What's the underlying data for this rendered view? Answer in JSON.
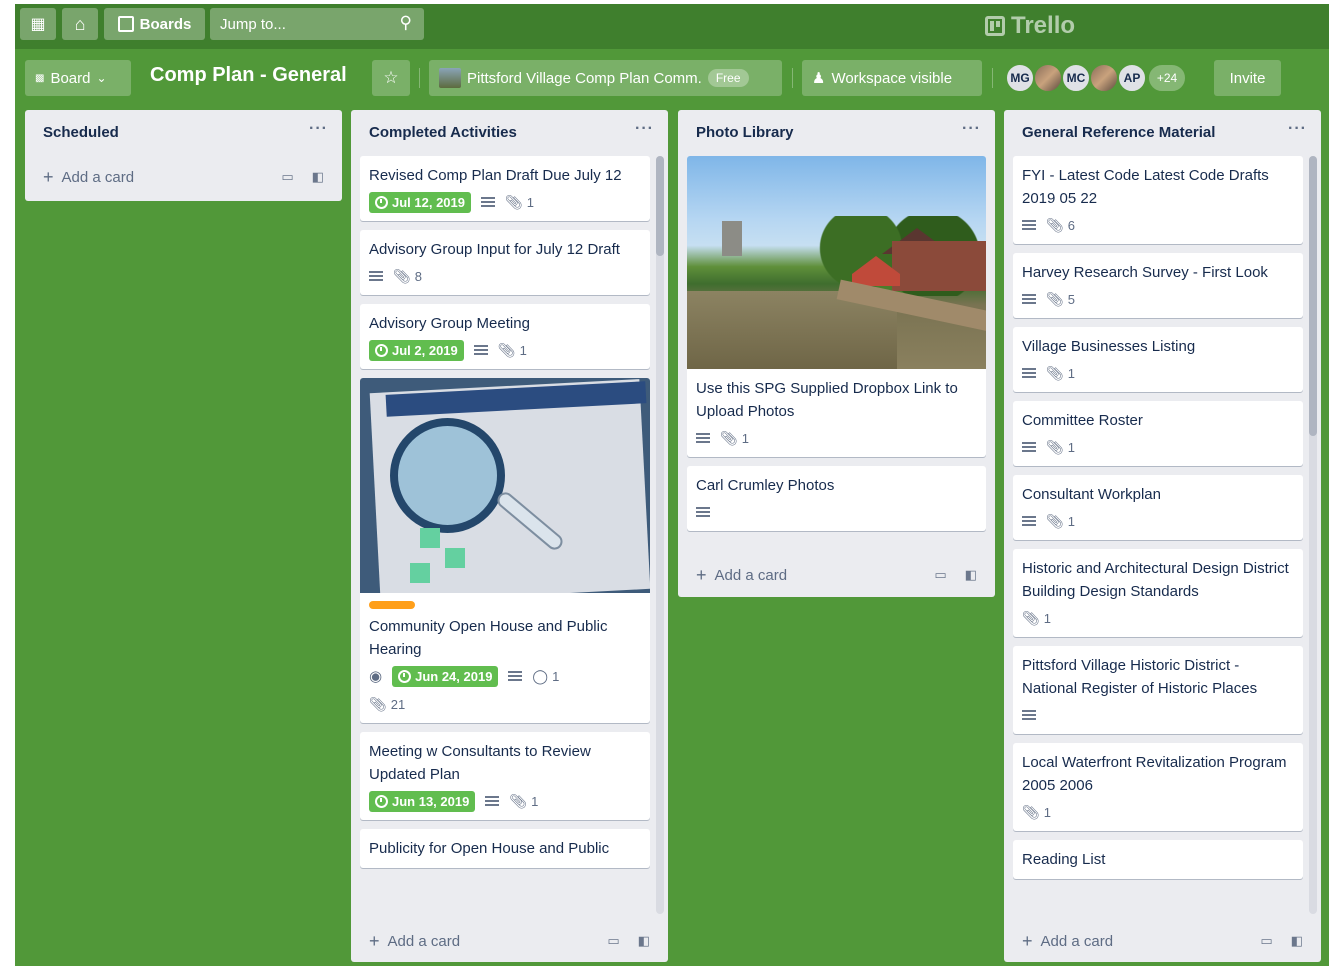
{
  "topbar": {
    "boards_label": "Boards",
    "search_placeholder": "Jump to...",
    "logo_text": "Trello"
  },
  "board_header": {
    "view_label": "Board",
    "title": "Comp Plan - General",
    "workspace_name": "Pittsford Village Comp Plan Comm.",
    "workspace_plan": "Free",
    "visibility_label": "Workspace visible",
    "members": [
      "MG",
      "MC",
      "AP"
    ],
    "more_members": "+24",
    "invite_label": "Invite"
  },
  "lists": [
    {
      "title": "Scheduled",
      "add_label": "Add a card",
      "cards": []
    },
    {
      "title": "Completed Activities",
      "add_label": "Add a card",
      "cards": [
        {
          "title": "Revised Comp Plan Draft Due July 12",
          "due": "Jul 12, 2019",
          "description": true,
          "attachments": "1"
        },
        {
          "title": "Advisory Group Input for July 12 Draft",
          "description": true,
          "attachments": "8"
        },
        {
          "title": "Advisory Group Meeting",
          "due": "Jul 2, 2019",
          "description": true,
          "attachments": "1"
        },
        {
          "title": "Community Open House and Public Hearing",
          "cover": "document-photo",
          "label_color": "#ff9f1a",
          "watching": true,
          "due": "Jun 24, 2019",
          "description": true,
          "comments": "1",
          "attachments": "21"
        },
        {
          "title": "Meeting w Consultants to Review Updated Plan",
          "due": "Jun 13, 2019",
          "description": true,
          "attachments": "1"
        },
        {
          "title": "Publicity for Open House and Public"
        }
      ]
    },
    {
      "title": "Photo Library",
      "add_label": "Add a card",
      "cards": [
        {
          "title": "Use this SPG Supplied Dropbox Link to Upload Photos",
          "cover": "canal-photo",
          "description": true,
          "attachments": "1"
        },
        {
          "title": "Carl Crumley Photos",
          "description": true
        }
      ]
    },
    {
      "title": "General Reference Material",
      "add_label": "Add a card",
      "cards": [
        {
          "title": "FYI - Latest Code Latest Code Drafts 2019 05 22",
          "description": true,
          "attachments": "6"
        },
        {
          "title": "Harvey Research Survey - First Look",
          "description": true,
          "attachments": "5"
        },
        {
          "title": "Village Businesses Listing",
          "description": true,
          "attachments": "1"
        },
        {
          "title": "Committee Roster",
          "description": true,
          "attachments": "1"
        },
        {
          "title": "Consultant Workplan",
          "description": true,
          "attachments": "1"
        },
        {
          "title": "Historic and Architectural Design District Building Design Standards",
          "attachments": "1"
        },
        {
          "title": "Pittsford Village Historic District - National Register of Historic Places",
          "description": true
        },
        {
          "title": "Local Waterfront Revitalization Program 2005 2006",
          "attachments": "1"
        },
        {
          "title": "Reading List"
        }
      ]
    }
  ],
  "colors": {
    "board_background": "#519839",
    "due_badge": "#61bd4f",
    "list_background": "#ebecf0"
  }
}
